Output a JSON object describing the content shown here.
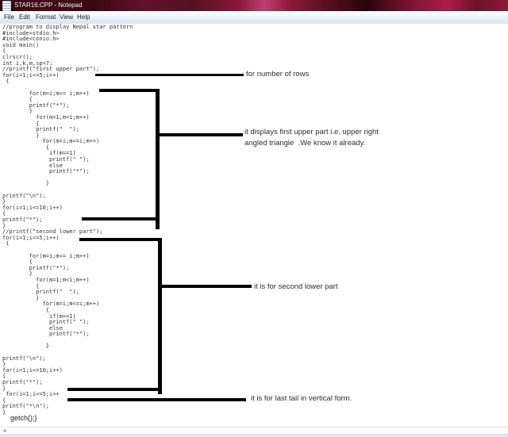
{
  "window": {
    "title": "STAR16.CPP - Notepad"
  },
  "menu": {
    "items": [
      "File",
      "Edit",
      "Format",
      "View",
      "Help"
    ]
  },
  "code": {
    "main": "//program to display Nepal star pattern\n#include<stdio.h>\n#include<conio.h>\nvoid main()\n{\nclrscr();\nint i,k,m,sp=7;\n//printf(\"first upper part\");\nfor(i=1;i<=5;i++)\n {\n\n        for(m=i;m<= i;m++)\n        {\n        printf(\"*\");\n        }\n          for(m=1;m<i;m++)\n          {\n          printf(\"  \");\n          }\n            for(m=i;m<=i;m++)\n             {\n              if(m==1)\n              printf(\" \");\n              else\n              printf(\"*\");\n\n             }\n\nprintf(\"\\n\");\n}\nfor(i=1;i<=10;i++)\n{\nprintf(\"*\");\n}\n//printf(\"second lower part\");\nfor(i=1;i<=5;i++)\n {\n\n        for(m=i;m<= i;m++)\n        {\n        printf(\"*\");\n        }\n          for(m=1;m<i;m++)\n          {\n          printf(\"  \");\n          }\n            for(m=i;m<=i;m++)\n             {\n              if(m==1)\n              printf(\" \");\n              else\n              printf(\"*\");\n\n             }\n\nprintf(\"\\n\");\n}\nfor(i=1;i<=10;i++)\n{\nprintf(\"*\");\n}\n for(i=1;i<=5;i++\n{\nprintf(\"*\\n\");\n}",
    "last_line": "getch();}"
  },
  "annotations": {
    "rows": "for number of rows",
    "upper_part": "it displays first upper part i.e. upper right\nangled triangle  .We know it already.",
    "lower_part": "it is for second lower part",
    "tail": "it is for last tail in vertical form."
  },
  "scrollbar": {
    "left_arrow": "◄"
  },
  "colors": {
    "titlebar_red_dark": "#30060f",
    "titlebar_red_bright": "#a91c48",
    "menubar_bg": "#dde6f1",
    "code_text": "#333333",
    "annotation_ink": "#000000",
    "editor_bg": "#ffffff"
  }
}
